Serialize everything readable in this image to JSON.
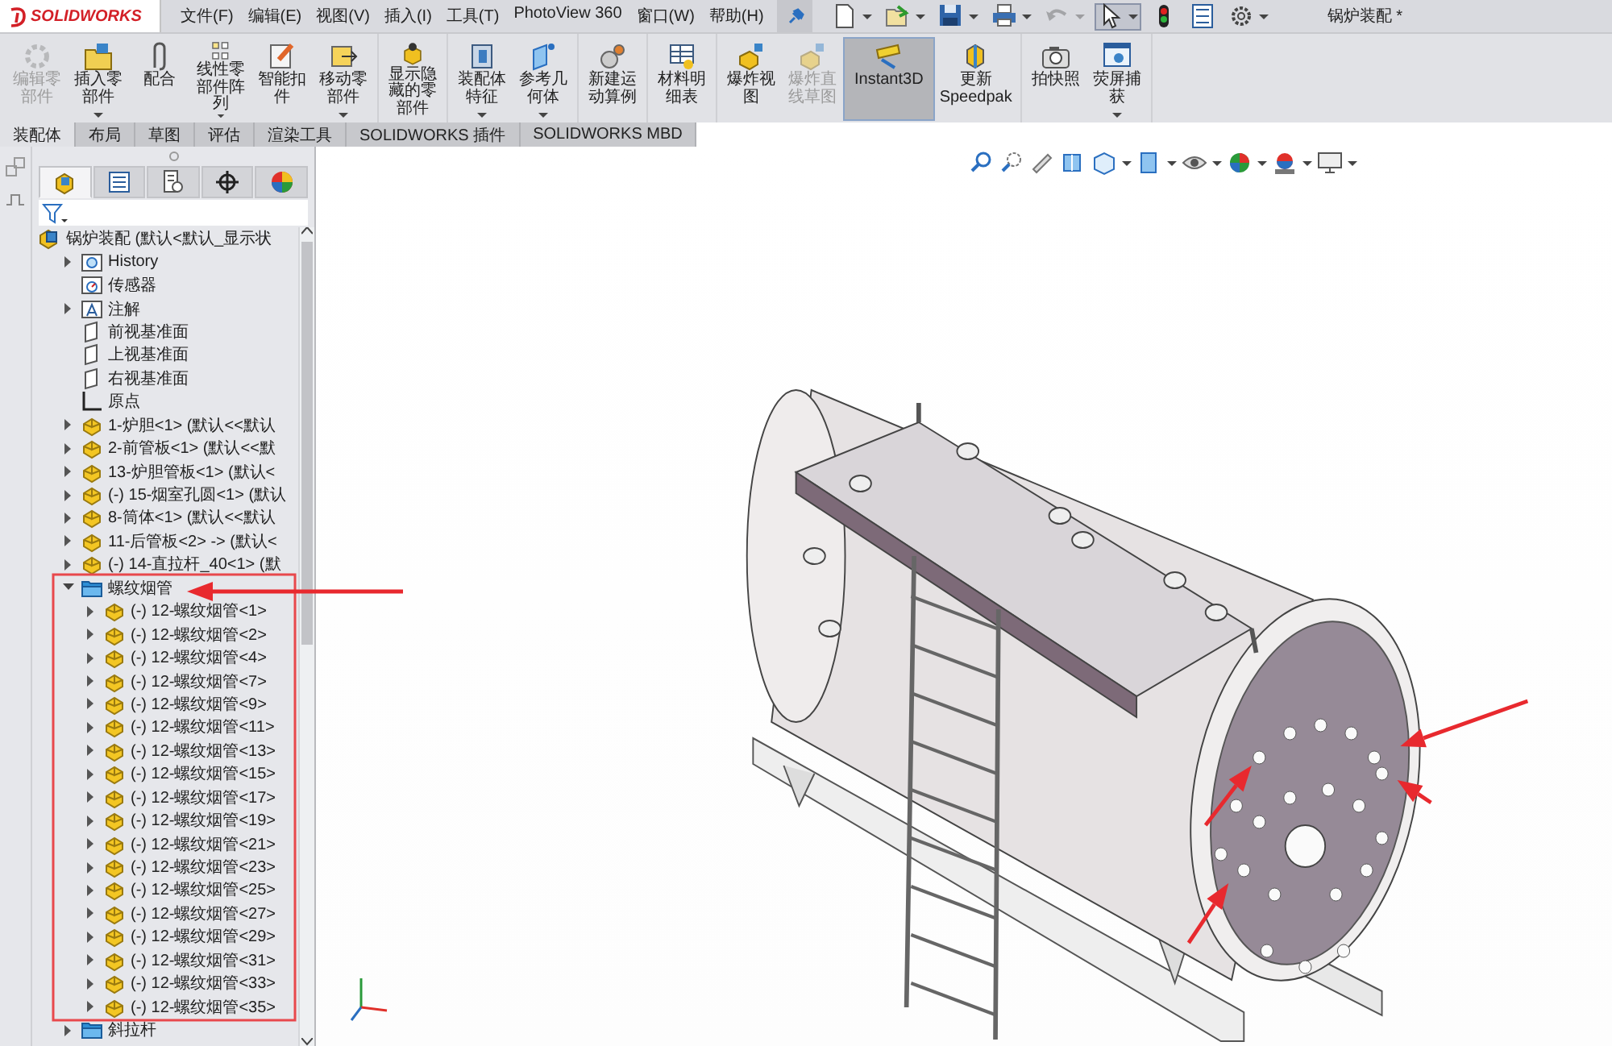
{
  "app": {
    "logo": "SOLIDWORKS",
    "menus": [
      "文件(F)",
      "编辑(E)",
      "视图(V)",
      "插入(I)",
      "工具(T)",
      "PhotoView 360",
      "窗口(W)",
      "帮助(H)"
    ],
    "title": "锅炉装配 *"
  },
  "quick_toolbar": [
    {
      "kind": "new",
      "disabled": false,
      "pressed": false,
      "menu": true
    },
    {
      "kind": "open",
      "disabled": false,
      "pressed": false,
      "menu": true
    },
    {
      "kind": "save",
      "disabled": false,
      "pressed": false,
      "menu": true
    },
    {
      "kind": "print",
      "disabled": false,
      "pressed": false,
      "menu": true
    },
    {
      "kind": "undo",
      "disabled": true,
      "pressed": false,
      "menu": true
    },
    {
      "kind": "select",
      "disabled": false,
      "pressed": true,
      "menu": true
    },
    {
      "kind": "rebuild",
      "disabled": false,
      "pressed": false,
      "menu": false
    },
    {
      "kind": "properties",
      "disabled": false,
      "pressed": false,
      "menu": false
    },
    {
      "kind": "options",
      "disabled": false,
      "pressed": false,
      "menu": true
    }
  ],
  "ribbon": [
    {
      "tools": [
        {
          "label": "编辑零部件",
          "kind": "edit-part",
          "disabled": true,
          "menu": false,
          "on": false
        },
        {
          "label": "插入零部件",
          "kind": "insert",
          "disabled": false,
          "menu": true,
          "on": false
        },
        {
          "label": "配合",
          "kind": "mate",
          "disabled": false,
          "menu": false,
          "on": false
        },
        {
          "label": "线性零部件阵列",
          "kind": "pattern",
          "disabled": false,
          "menu": true,
          "on": false
        },
        {
          "label": "智能扣件",
          "kind": "fastener",
          "disabled": false,
          "menu": false,
          "on": false
        },
        {
          "label": "移动零部件",
          "kind": "move",
          "disabled": false,
          "menu": true,
          "on": false
        }
      ]
    },
    {
      "tools": [
        {
          "label": "显示隐藏的零部件",
          "kind": "show-hidden",
          "disabled": false,
          "menu": false,
          "on": false
        }
      ]
    },
    {
      "tools": [
        {
          "label": "装配体特征",
          "kind": "features",
          "disabled": false,
          "menu": true,
          "on": false
        },
        {
          "label": "参考几何体",
          "kind": "reference",
          "disabled": false,
          "menu": true,
          "on": false
        }
      ]
    },
    {
      "tools": [
        {
          "label": "新建运动算例",
          "kind": "motion",
          "disabled": false,
          "menu": false,
          "on": false
        }
      ]
    },
    {
      "tools": [
        {
          "label": "材料明细表",
          "kind": "bom",
          "disabled": false,
          "menu": false,
          "on": false
        }
      ]
    },
    {
      "tools": [
        {
          "label": "爆炸视图",
          "kind": "explode",
          "disabled": false,
          "menu": false,
          "on": false
        },
        {
          "label": "爆炸直线草图",
          "kind": "explode",
          "disabled": true,
          "menu": false,
          "on": false
        },
        {
          "label": "Instant3D",
          "kind": "instant3d",
          "disabled": false,
          "menu": false,
          "on": true
        },
        {
          "label": "更新 Speedpak",
          "kind": "speedpak",
          "disabled": false,
          "menu": false,
          "on": false
        }
      ]
    },
    {
      "tools": [
        {
          "label": "拍快照",
          "kind": "snapshot",
          "disabled": false,
          "menu": false,
          "on": false
        },
        {
          "label": "荧屏捕获",
          "kind": "capture",
          "disabled": false,
          "menu": true,
          "on": false
        }
      ]
    }
  ],
  "tabs": [
    {
      "label": "装配体",
      "selected": true
    },
    {
      "label": "布局",
      "selected": false
    },
    {
      "label": "草图",
      "selected": false
    },
    {
      "label": "评估",
      "selected": false
    },
    {
      "label": "渲染工具",
      "selected": false
    },
    {
      "label": "SOLIDWORKS 插件",
      "selected": false
    },
    {
      "label": "SOLIDWORKS MBD",
      "selected": false
    }
  ],
  "panel_tabs": [
    {
      "kind": "feature-tree",
      "selected": true
    },
    {
      "kind": "property",
      "selected": false
    },
    {
      "kind": "configuration",
      "selected": false
    },
    {
      "kind": "dimxpert",
      "selected": false
    },
    {
      "kind": "display",
      "selected": false
    }
  ],
  "tree": {
    "items": [
      {
        "label": "锅炉装配  (默认<默认_显示状",
        "kind": "assembly",
        "children": [
          {
            "label": "History",
            "kind": "history",
            "expanded": false
          },
          {
            "label": "传感器",
            "kind": "sensor"
          },
          {
            "label": "注解",
            "kind": "annotation",
            "expanded": false
          },
          {
            "label": "前视基准面",
            "kind": "plane"
          },
          {
            "label": "上视基准面",
            "kind": "plane"
          },
          {
            "label": "右视基准面",
            "kind": "plane"
          },
          {
            "label": "原点",
            "kind": "origin"
          },
          {
            "label": "1-炉胆<1> (默认<<默认",
            "kind": "part",
            "expanded": false
          },
          {
            "label": "2-前管板<1> (默认<<默",
            "kind": "part",
            "expanded": false
          },
          {
            "label": "13-炉胆管板<1> (默认<",
            "kind": "part",
            "expanded": false
          },
          {
            "label": "(-) 15-烟室孔圆<1> (默认",
            "kind": "part",
            "expanded": false
          },
          {
            "label": "8-筒体<1> (默认<<默认",
            "kind": "part",
            "expanded": false
          },
          {
            "label": "11-后管板<2> -> (默认<",
            "kind": "part",
            "expanded": false
          },
          {
            "label": "(-) 14-直拉杆_40<1> (默",
            "kind": "part",
            "expanded": false
          },
          {
            "label": "螺纹烟管",
            "kind": "folder",
            "expanded": true,
            "children": [
              {
                "label": "(-) 12-螺纹烟管<1>",
                "kind": "part",
                "expanded": false
              },
              {
                "label": "(-) 12-螺纹烟管<2>",
                "kind": "part",
                "expanded": false
              },
              {
                "label": "(-) 12-螺纹烟管<4>",
                "kind": "part",
                "expanded": false
              },
              {
                "label": "(-) 12-螺纹烟管<7>",
                "kind": "part",
                "expanded": false
              },
              {
                "label": "(-) 12-螺纹烟管<9>",
                "kind": "part",
                "expanded": false
              },
              {
                "label": "(-) 12-螺纹烟管<11>",
                "kind": "part",
                "expanded": false
              },
              {
                "label": "(-) 12-螺纹烟管<13>",
                "kind": "part",
                "expanded": false
              },
              {
                "label": "(-) 12-螺纹烟管<15>",
                "kind": "part",
                "expanded": false
              },
              {
                "label": "(-) 12-螺纹烟管<17>",
                "kind": "part",
                "expanded": false
              },
              {
                "label": "(-) 12-螺纹烟管<19>",
                "kind": "part",
                "expanded": false
              },
              {
                "label": "(-) 12-螺纹烟管<21>",
                "kind": "part",
                "expanded": false
              },
              {
                "label": "(-) 12-螺纹烟管<23>",
                "kind": "part",
                "expanded": false
              },
              {
                "label": "(-) 12-螺纹烟管<25>",
                "kind": "part",
                "expanded": false
              },
              {
                "label": "(-) 12-螺纹烟管<27>",
                "kind": "part",
                "expanded": false
              },
              {
                "label": "(-) 12-螺纹烟管<29>",
                "kind": "part",
                "expanded": false
              },
              {
                "label": "(-) 12-螺纹烟管<31>",
                "kind": "part",
                "expanded": false
              },
              {
                "label": "(-) 12-螺纹烟管<33>",
                "kind": "part",
                "expanded": false
              },
              {
                "label": "(-) 12-螺纹烟管<35>",
                "kind": "part",
                "expanded": false
              }
            ]
          },
          {
            "label": "斜拉杆",
            "kind": "folder",
            "expanded": false
          }
        ]
      }
    ]
  }
}
